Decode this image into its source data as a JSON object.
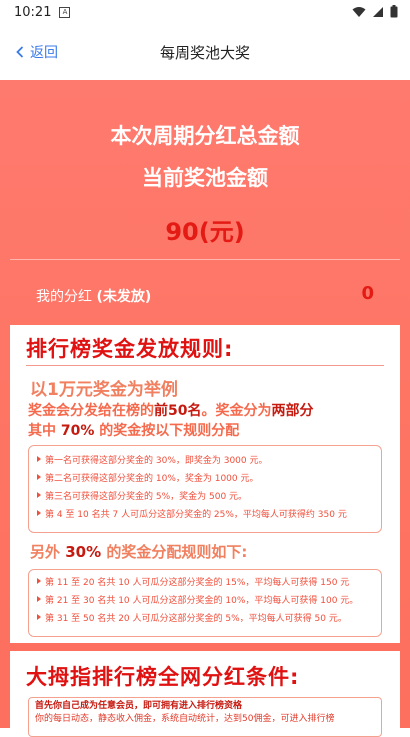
{
  "statusbar": {
    "time": "10:21"
  },
  "nav": {
    "back_label": "返回",
    "title": "每周奖池大奖"
  },
  "hero": {
    "title_line1": "本次周期分红总金额",
    "title_line2": "当前奖池金额",
    "pool_amount": "90(元)",
    "my_bonus_label": "我的分红",
    "my_bonus_status": "(未发放)",
    "my_bonus_value": "0"
  },
  "rules": {
    "title": "排行榜奖金发放规则:",
    "example": "以1万元奖金为举例",
    "para_part1": "奖金会分发给在榜的",
    "para_top": "前50名",
    "para_part2": "。奖金分为",
    "para_two": "两部分",
    "para_line2a": "其中",
    "para_pct": "70%",
    "para_line2b": "的奖金按以下规则分配",
    "group1": [
      "第一名可获得这部分奖金的 30%，即奖金为 3000 元。",
      "第二名可获得这部分奖金的 10%，奖金为 1000 元。",
      "第三名可获得这部分奖金的 5%，奖金为 500 元。",
      "第 4 至 10 名共 7 人可瓜分这部分奖金的 25%，平均每人可获得约 350 元"
    ],
    "other_a": "另外",
    "other_pct": "30%",
    "other_b": "的奖金分配规则如下:",
    "group2": [
      "第 11 至 20 名共 10 人可瓜分这部分奖金的 15%，平均每人可获得 150 元",
      "第 21 至 30 名共 10 人可瓜分这部分奖金的 10%，平均每人可获得 100 元。",
      "第 31 至 50 名共 20 人可瓜分这部分奖金的 5%，平均每人可获得 50 元。"
    ]
  },
  "conditions": {
    "title": "大拇指排行榜全网分红条件:",
    "line1": "首先你自己成为任意会员，即可拥有进入排行榜资格",
    "line2": "你的每日动态，静态收入佣金，系统自动统计，达到50佣金，可进入排行榜"
  },
  "colors": {
    "hero": "#fe7564",
    "accent_red": "#e01111",
    "link_blue": "#3b7be8"
  }
}
